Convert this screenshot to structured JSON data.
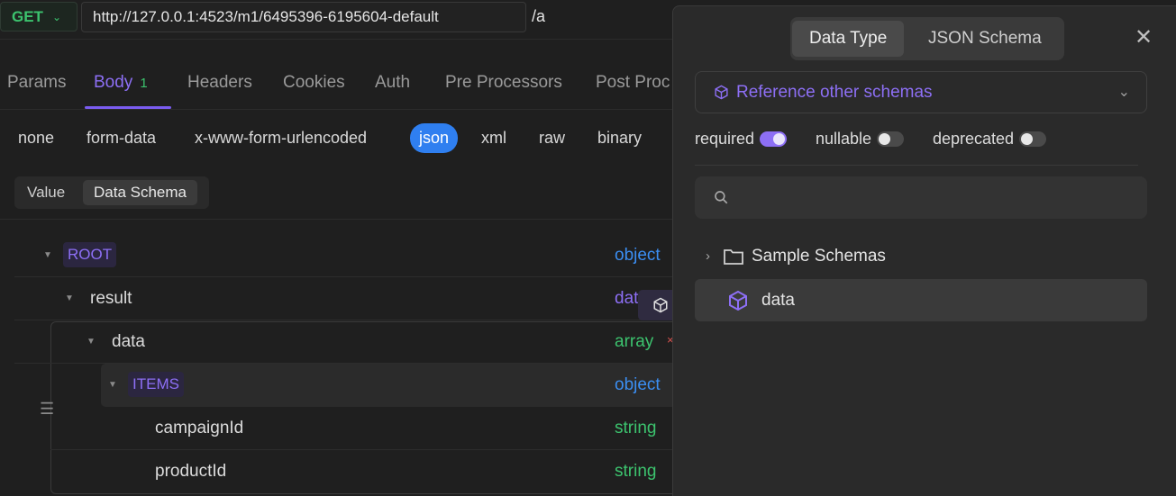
{
  "request": {
    "method": "GET",
    "url": "http://127.0.0.1:4523/m1/6495396-6195604-default",
    "path": "/a"
  },
  "tabs": [
    {
      "label": "Params"
    },
    {
      "label": "Body",
      "badge": "1"
    },
    {
      "label": "Headers"
    },
    {
      "label": "Cookies"
    },
    {
      "label": "Auth"
    },
    {
      "label": "Pre Processors"
    },
    {
      "label": "Post Proc"
    }
  ],
  "body_types": [
    "none",
    "form-data",
    "x-www-form-urlencoded",
    "json",
    "xml",
    "raw",
    "binary"
  ],
  "body_active": "json",
  "view_toggle": {
    "value": "Value",
    "schema": "Data Schema"
  },
  "schema_rows": [
    {
      "name": "ROOT",
      "type": "object"
    },
    {
      "name": "result",
      "type": "dat"
    },
    {
      "name": "data",
      "type": "array"
    },
    {
      "name": "ITEMS",
      "type": "object"
    },
    {
      "name": "campaignId",
      "type": "string"
    },
    {
      "name": "productId",
      "type": "string"
    }
  ],
  "panel": {
    "tabs": {
      "data_type": "Data Type",
      "json_schema": "JSON Schema"
    },
    "reference": "Reference other schemas",
    "flags": {
      "required": "required",
      "nullable": "nullable",
      "deprecated": "deprecated"
    },
    "search_placeholder": "",
    "tree": [
      {
        "label": "Sample Schemas"
      },
      {
        "label": "data"
      }
    ]
  },
  "colors": {
    "accent": "#8d6ff5",
    "get": "#3cc36e",
    "object": "#3b8ef2",
    "string": "#3cc36e",
    "json_pill": "#2f7ff0"
  }
}
